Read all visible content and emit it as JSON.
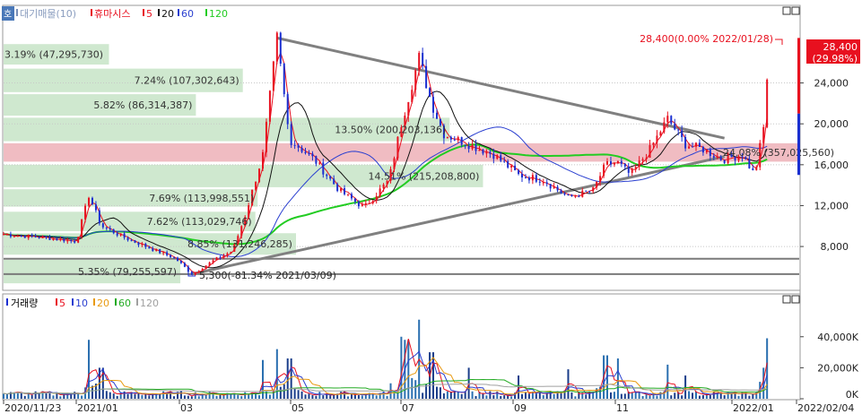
{
  "legend": {
    "price_title": "대기매물(10)",
    "price_ma_name": "휴마시스",
    "price_ma_periods": [
      "5",
      "20",
      "60",
      "120"
    ],
    "volume_title": "거래량",
    "volume_ma_periods": [
      "5",
      "10",
      "20",
      "60",
      "120"
    ]
  },
  "corner_label": "호",
  "colors": {
    "ma5": "#e8101f",
    "ma20": "#111111",
    "ma60": "#2a3fd0",
    "ma120": "#22cc22",
    "ma_vol20": "#e89a10",
    "ma_vol120": "#a0a0a0",
    "candle_up": "#e8101f",
    "candle_down": "#1a2fd0",
    "band": "#cfe8cf",
    "band_highlight": "#f0bcc2",
    "trendline": "#808080"
  },
  "last_price": {
    "value": "28,400",
    "change": "(29.98%)"
  },
  "chart_data": [
    {
      "type": "candlestick",
      "title": "휴마시스",
      "yticks": [
        8000,
        12000,
        16000,
        20000,
        24000
      ],
      "ytick_labels": [
        "8,000",
        "12,000",
        "16,000",
        "20,000",
        "24,000"
      ],
      "ylim": [
        3800,
        31500
      ],
      "x_ticks": [
        "2020/11/23",
        "2021/01",
        "03",
        "05",
        "07",
        "09",
        "11",
        "2022/01",
        "2022/02/04"
      ],
      "resistance_bands": [
        {
          "label": "3.19% (47,295,730)",
          "pct": 3.19,
          "volume": 47295730,
          "price_low": 25800,
          "price_high": 27800
        },
        {
          "label": "7.24% (107,302,643)",
          "pct": 7.24,
          "volume": 107302643,
          "price_low": 23100,
          "price_high": 25400
        },
        {
          "label": "5.82% (86,314,387)",
          "pct": 5.82,
          "volume": 86314387,
          "price_low": 20800,
          "price_high": 22900
        },
        {
          "label": "13.50% (200,203,136)",
          "pct": 13.5,
          "volume": 200203136,
          "price_low": 18300,
          "price_high": 20600
        },
        {
          "label": "24.08% (357,025,560)",
          "pct": 24.08,
          "volume": 357025560,
          "price_low": 16300,
          "price_high": 18100,
          "highlight": true
        },
        {
          "label": "14.51% (215,208,800)",
          "pct": 14.51,
          "volume": 215208800,
          "price_low": 13800,
          "price_high": 16000
        },
        {
          "label": "7.69% (113,998,551)",
          "pct": 7.69,
          "volume": 113998551,
          "price_low": 11900,
          "price_high": 13600
        },
        {
          "label": "7.62% (113,029,746)",
          "pct": 7.62,
          "volume": 113029746,
          "price_low": 9500,
          "price_high": 11400
        },
        {
          "label": "8.85% (131,246,285)",
          "pct": 8.85,
          "volume": 131246285,
          "price_low": 7200,
          "price_high": 9300
        },
        {
          "label": "5.35% (79,255,597)",
          "pct": 5.35,
          "volume": 79255597,
          "price_low": 4400,
          "price_high": 6700
        }
      ],
      "annotations": {
        "high": "28,400(0.00% 2022/01/28)",
        "low": "5,300(-81.34% 2021/03/09)"
      },
      "support_lines": [
        6800,
        5300
      ],
      "trendlines": [
        {
          "from": [
            "2021/04/26",
            28400
          ],
          "to": [
            "2022/01/03",
            18600
          ]
        },
        {
          "from": [
            "2021/03/09",
            5300
          ],
          "to": [
            "2022/01/03",
            16800
          ]
        }
      ],
      "price_path": [
        [
          "2020/11/23",
          9200
        ],
        [
          "2020/12/20",
          8800
        ],
        [
          "2021/01/03",
          8500
        ],
        [
          "2021/01/10",
          13000
        ],
        [
          "2021/01/17",
          10000
        ],
        [
          "2021/01/31",
          8800
        ],
        [
          "2021/02/14",
          7800
        ],
        [
          "2021/02/28",
          6800
        ],
        [
          "2021/03/09",
          5300
        ],
        [
          "2021/03/21",
          6600
        ],
        [
          "2021/04/01",
          7600
        ],
        [
          "2021/04/08",
          11000
        ],
        [
          "2021/04/18",
          17000
        ],
        [
          "2021/04/26",
          28400
        ],
        [
          "2021/05/03",
          18500
        ],
        [
          "2021/05/17",
          16500
        ],
        [
          "2021/05/31",
          13500
        ],
        [
          "2021/06/14",
          11800
        ],
        [
          "2021/06/28",
          14500
        ],
        [
          "2021/07/05",
          20000
        ],
        [
          "2021/07/15",
          26500
        ],
        [
          "2021/07/22",
          22000
        ],
        [
          "2021/07/29",
          19000
        ],
        [
          "2021/08/12",
          18000
        ],
        [
          "2021/08/26",
          17000
        ],
        [
          "2021/09/09",
          15000
        ],
        [
          "2021/09/23",
          14500
        ],
        [
          "2021/10/07",
          12800
        ],
        [
          "2021/10/21",
          13500
        ],
        [
          "2021/10/28",
          16000
        ],
        [
          "2021/11/04",
          16200
        ],
        [
          "2021/11/11",
          15000
        ],
        [
          "2021/11/22",
          17500
        ],
        [
          "2021/12/02",
          20500
        ],
        [
          "2021/12/12",
          18000
        ],
        [
          "2021/12/22",
          17500
        ],
        [
          "2022/01/02",
          16500
        ],
        [
          "2022/01/13",
          17000
        ],
        [
          "2022/01/20",
          15000
        ],
        [
          "2022/01/26",
          20500
        ],
        [
          "2022/01/28",
          28400
        ]
      ]
    },
    {
      "type": "bar",
      "title": "거래량",
      "yticks": [
        0,
        20000,
        40000
      ],
      "ytick_labels": [
        "0K",
        "20,000K",
        "40,000K"
      ],
      "ylim": [
        0,
        52000
      ],
      "spikes": [
        [
          "2021/01/10",
          38000
        ],
        [
          "2021/01/17",
          20000
        ],
        [
          "2021/04/18",
          25000
        ],
        [
          "2021/04/26",
          32000
        ],
        [
          "2021/05/03",
          26000
        ],
        [
          "2021/07/05",
          40000
        ],
        [
          "2021/07/08",
          38000
        ],
        [
          "2021/07/15",
          51000
        ],
        [
          "2021/07/22",
          30000
        ],
        [
          "2021/08/12",
          20000
        ],
        [
          "2021/09/09",
          15000
        ],
        [
          "2021/10/07",
          19000
        ],
        [
          "2021/10/28",
          28000
        ],
        [
          "2021/11/04",
          26000
        ],
        [
          "2021/12/02",
          22000
        ],
        [
          "2021/12/12",
          15000
        ],
        [
          "2022/01/26",
          20000
        ],
        [
          "2022/01/28",
          39000
        ]
      ]
    }
  ]
}
